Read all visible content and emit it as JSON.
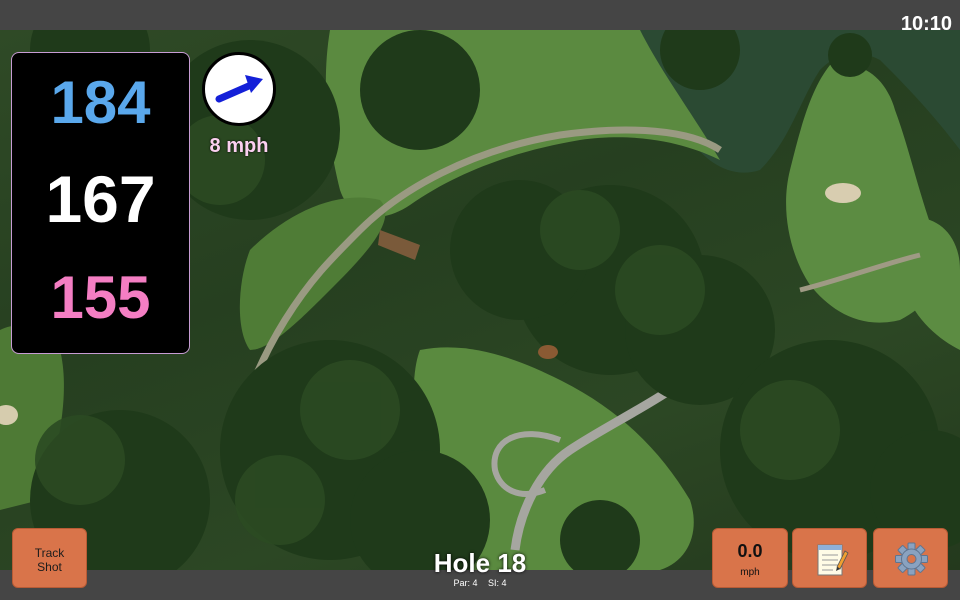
{
  "status": {
    "time": "10:10"
  },
  "distances": {
    "back": "184",
    "middle": "167",
    "front": "155"
  },
  "wind": {
    "speed_label": "8 mph",
    "icon": "wind-arrow-icon"
  },
  "hole": {
    "title": "Hole 18",
    "par": "Par: 4",
    "si": "SI: 4"
  },
  "buttons": {
    "track_shot_line1": "Track",
    "track_shot_line2": "Shot",
    "speed_value": "0.0",
    "speed_unit": "mph",
    "notes_icon": "notepad-icon",
    "settings_icon": "gear-icon"
  },
  "colors": {
    "back_distance": "#5aa8ec",
    "middle_distance": "#ffffff",
    "front_distance": "#f47ec3",
    "button": "#d9744a"
  }
}
